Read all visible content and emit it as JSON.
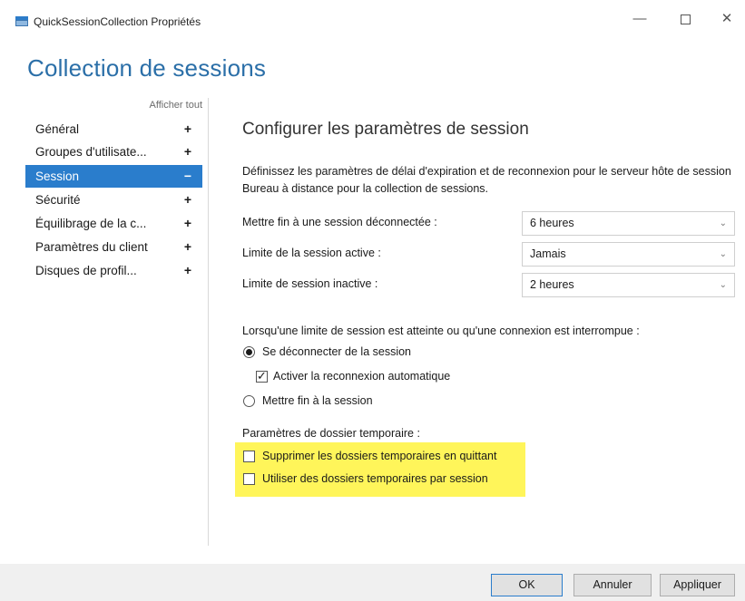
{
  "window": {
    "title": "QuickSessionCollection Propriétés",
    "minimize": "—",
    "close": "✕"
  },
  "page_title": "Collection de sessions",
  "nav": {
    "show_all": "Afficher tout",
    "items": [
      {
        "label": "Général",
        "sign": "+"
      },
      {
        "label": "Groupes d'utilisate...",
        "sign": "+"
      },
      {
        "label": "Session",
        "sign": "−"
      },
      {
        "label": "Sécurité",
        "sign": "+"
      },
      {
        "label": "Équilibrage de la c...",
        "sign": "+"
      },
      {
        "label": "Paramètres du client",
        "sign": "+"
      },
      {
        "label": "Disques de profil...",
        "sign": "+"
      }
    ],
    "active_index": 2
  },
  "section": {
    "title": "Configurer les paramètres de session",
    "description": "Définissez les paramètres de délai d'expiration et de reconnexion pour le serveur hôte de session Bureau à distance pour la collection de sessions."
  },
  "fields": [
    {
      "label": "Mettre fin à une session déconnectée :",
      "value": "6 heures"
    },
    {
      "label": "Limite de la session active :",
      "value": "Jamais"
    },
    {
      "label": "Limite de session inactive :",
      "value": "2 heures"
    }
  ],
  "chevron": "⌄",
  "limit_reached": {
    "label": "Lorsqu'une limite de session est atteinte ou qu'une connexion est interrompue :",
    "disconnect": {
      "label": "Se déconnecter de la session",
      "selected": true
    },
    "auto_reconnect": {
      "label": "Activer la reconnexion automatique",
      "checked": true
    },
    "end_session": {
      "label": "Mettre fin à la session",
      "selected": false
    }
  },
  "temp_folders": {
    "label": "Paramètres de dossier temporaire :",
    "delete_on_exit": {
      "label": "Supprimer les dossiers temporaires en quittant",
      "checked": false
    },
    "per_session": {
      "label": "Utiliser des dossiers temporaires par session",
      "checked": false
    },
    "highlight_color": "#fff55a"
  },
  "buttons": {
    "ok": "OK",
    "cancel": "Annuler",
    "apply": "Appliquer"
  },
  "colors": {
    "accent": "#2a7dcc",
    "title": "#2b6fa8"
  }
}
